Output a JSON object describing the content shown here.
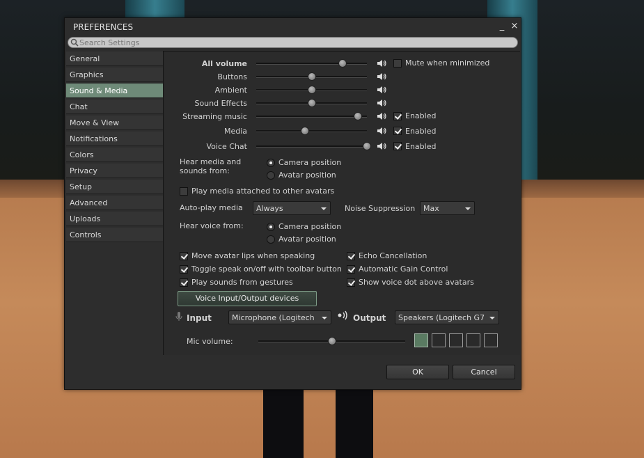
{
  "window": {
    "title": "PREFERENCES",
    "minimize_glyph": "_",
    "close_glyph": "×"
  },
  "search": {
    "placeholder": "Search Settings",
    "icon": "search-icon"
  },
  "sidebar": {
    "items": [
      {
        "label": "General"
      },
      {
        "label": "Graphics"
      },
      {
        "label": "Sound & Media",
        "active": true
      },
      {
        "label": "Chat"
      },
      {
        "label": "Move & View"
      },
      {
        "label": "Notifications"
      },
      {
        "label": "Colors"
      },
      {
        "label": "Privacy"
      },
      {
        "label": "Setup"
      },
      {
        "label": "Advanced"
      },
      {
        "label": "Uploads"
      },
      {
        "label": "Controls"
      }
    ]
  },
  "volume": {
    "all": {
      "label": "All volume",
      "level": 0.78,
      "mute_label": "Mute when minimized",
      "mute_checked": false
    },
    "buttons": {
      "label": "Buttons",
      "level": 0.5
    },
    "ambient": {
      "label": "Ambient",
      "level": 0.5
    },
    "sound_effects": {
      "label": "Sound Effects",
      "level": 0.5
    },
    "streaming_music": {
      "label": "Streaming music",
      "level": 0.92,
      "enabled_label": "Enabled",
      "enabled": true
    },
    "media": {
      "label": "Media",
      "level": 0.44,
      "enabled_label": "Enabled",
      "enabled": true
    },
    "voice_chat": {
      "label": "Voice Chat",
      "level": 1.0,
      "enabled_label": "Enabled",
      "enabled": true
    }
  },
  "hear_media": {
    "label_line1": "Hear media and",
    "label_line2": "sounds from:",
    "options": [
      "Camera position",
      "Avatar position"
    ],
    "selected": 0
  },
  "play_attached": {
    "label": "Play media attached to other avatars",
    "checked": false
  },
  "autoplay": {
    "label": "Auto-play media",
    "value": "Always"
  },
  "noise": {
    "label": "Noise Suppression",
    "value": "Max"
  },
  "hear_voice": {
    "label": "Hear voice from:",
    "options": [
      "Camera position",
      "Avatar position"
    ],
    "selected": 0
  },
  "options_left": [
    {
      "label": "Move avatar lips when speaking",
      "checked": true
    },
    {
      "label": "Toggle speak on/off with toolbar button",
      "checked": true
    },
    {
      "label": "Play sounds from gestures",
      "checked": true
    }
  ],
  "options_right": [
    {
      "label": "Echo Cancellation",
      "checked": true
    },
    {
      "label": "Automatic Gain Control",
      "checked": true
    },
    {
      "label": "Show voice dot above avatars",
      "checked": true
    }
  ],
  "voice_devices_button": "Voice Input/Output devices",
  "input": {
    "label": "Input",
    "value": "Microphone (Logitech"
  },
  "output": {
    "label": "Output",
    "value": "Speakers (Logitech G7"
  },
  "mic": {
    "label": "Mic volume:",
    "level": 0.5,
    "meter_lit": 1,
    "meter_total": 5
  },
  "footer": {
    "ok": "OK",
    "cancel": "Cancel"
  },
  "colors": {
    "accent": "#6e8a78",
    "window_bg": "#2d2d2d"
  }
}
